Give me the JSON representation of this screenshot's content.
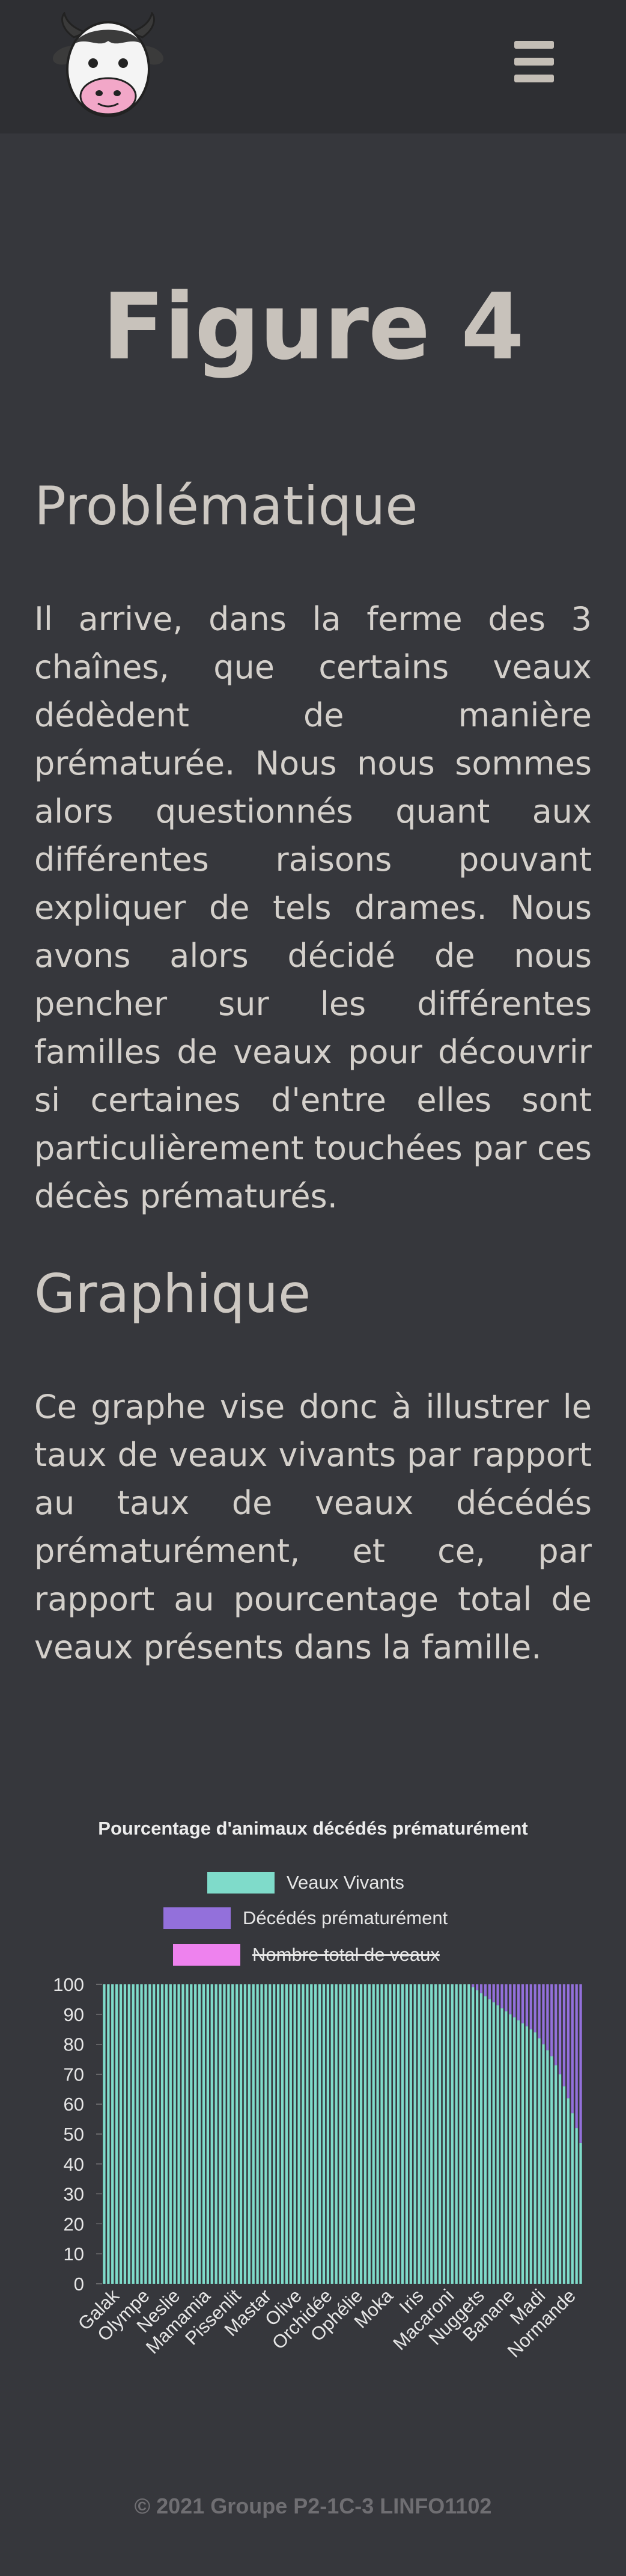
{
  "header": {
    "logo_icon": "cow-face-icon",
    "menu_icon": "hamburger-menu-icon"
  },
  "page": {
    "title": "Figure 4",
    "section1_heading": "Problématique",
    "section1_text": "Il arrive, dans la ferme des 3 chaînes, que certains veaux dédèdent de manière prématurée. Nous nous sommes alors questionnés quant aux différentes raisons pouvant expliquer de tels drames. Nous avons alors décidé de nous pencher sur les différentes familles de veaux pour découvrir si certaines d'entre elles sont particulièrement touchées par ces décès prématurés.",
    "section2_heading": "Graphique",
    "section2_text": "Ce graphe vise donc à illustrer le taux de veaux vivants par rapport au taux de veaux décédés prématurément, et ce, par rapport au pourcentage total de veaux présents dans la famille."
  },
  "colors": {
    "alive": "#7fdbca",
    "dead": "#9370db",
    "total": "#ee82ee",
    "background": "#36373c"
  },
  "chart_data": {
    "type": "bar",
    "stacked": true,
    "title": "Pourcentage d'animaux décédés prématurément",
    "legend_position": "top",
    "ylim": [
      0,
      100
    ],
    "yticks": [
      0,
      10,
      20,
      30,
      40,
      50,
      60,
      70,
      80,
      90,
      100
    ],
    "series": [
      {
        "name": "Veaux Vivants",
        "hidden": false
      },
      {
        "name": "Décédés prématurément",
        "hidden": false
      },
      {
        "name": "Nombre total de veaux",
        "hidden": true
      }
    ],
    "category_count": 116,
    "visible_category_labels": [
      "Galak",
      "Olympe",
      "Neslie",
      "Mamamia",
      "Pissenlit",
      "Mastar",
      "Olive",
      "Orchidée",
      "Ophélie",
      "Moka",
      "Iris",
      "Macaroni",
      "Nuggets",
      "Banane",
      "Madi",
      "Normande"
    ],
    "deaths_percent_last_categories": [
      1,
      2,
      3,
      4,
      5,
      6,
      7,
      8,
      9,
      10,
      11,
      12,
      13,
      14,
      15,
      16,
      18,
      20,
      22,
      24,
      27,
      30,
      34,
      38,
      43,
      48,
      53
    ],
    "notes": "Values sorted ascending by death percentage; the first 89 categories have 0% deaths (100% alive)."
  },
  "footer": {
    "text": "© 2021 Groupe P2-1C-3 LINFO1102"
  }
}
